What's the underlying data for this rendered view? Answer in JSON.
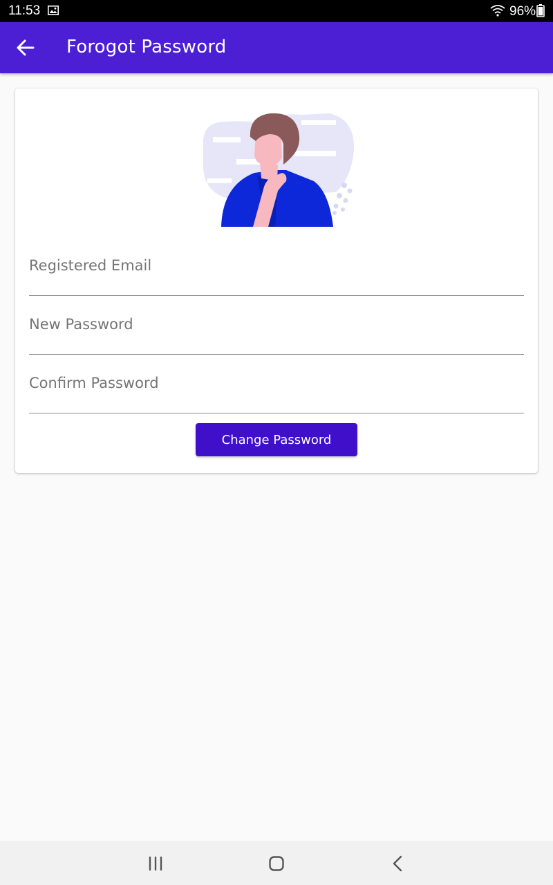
{
  "status_bar": {
    "time": "11:53",
    "battery_percent": "96%",
    "icons": [
      "gallery-icon",
      "wifi-icon",
      "battery-icon"
    ]
  },
  "app_bar": {
    "title": "Forogot Password",
    "back_icon": "arrow-left-icon",
    "background_color": "#4c1fd4"
  },
  "form": {
    "illustration": "thinking-person-illustration",
    "fields": [
      {
        "label": "Registered Email",
        "value": ""
      },
      {
        "label": "New Password",
        "value": ""
      },
      {
        "label": "Confirm Password",
        "value": ""
      }
    ],
    "submit_label": "Change Password",
    "button_color": "#3f0fc9"
  },
  "nav_bar": {
    "icons": [
      "recent-apps-icon",
      "home-icon",
      "back-icon"
    ]
  }
}
